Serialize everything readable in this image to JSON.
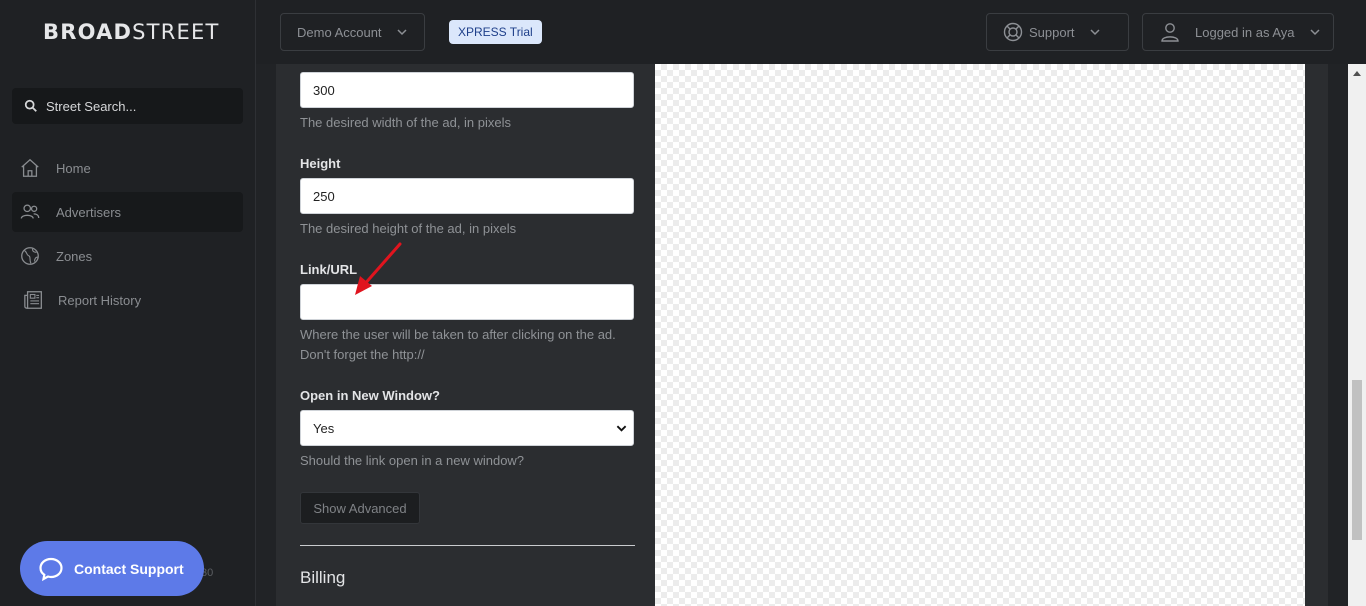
{
  "app": {
    "logo_bold": "BROAD",
    "logo_light": "STREET"
  },
  "sidebar": {
    "search_placeholder": "Street Search...",
    "items": [
      {
        "label": "Home",
        "icon": "home-icon"
      },
      {
        "label": "Advertisers",
        "icon": "users-icon",
        "active": true
      },
      {
        "label": "Zones",
        "icon": "globe-icon"
      },
      {
        "label": "Report History",
        "icon": "newspaper-icon"
      }
    ],
    "contact_support": "Contact Support",
    "hidden_number": "30"
  },
  "topbar": {
    "account": "Demo Account",
    "trial_badge": "XPRESS Trial",
    "support": "Support",
    "user": "Logged in as Aya"
  },
  "form": {
    "width_value": "300",
    "width_help": "The desired width of the ad, in pixels",
    "height_label": "Height",
    "height_value": "250",
    "height_help": "The desired height of the ad, in pixels",
    "link_label": "Link/URL",
    "link_value": "",
    "link_help_1": "Where the user will be taken to after clicking on the ad.",
    "link_help_2": "Don't forget the http://",
    "new_window_label": "Open in New Window?",
    "new_window_value": "Yes",
    "new_window_help": "Should the link open in a new window?",
    "show_advanced": "Show Advanced",
    "billing_heading": "Billing"
  },
  "colors": {
    "accent": "#5d7ae8",
    "trial_bg": "#dbe7fb",
    "annotation": "#e0141e"
  }
}
